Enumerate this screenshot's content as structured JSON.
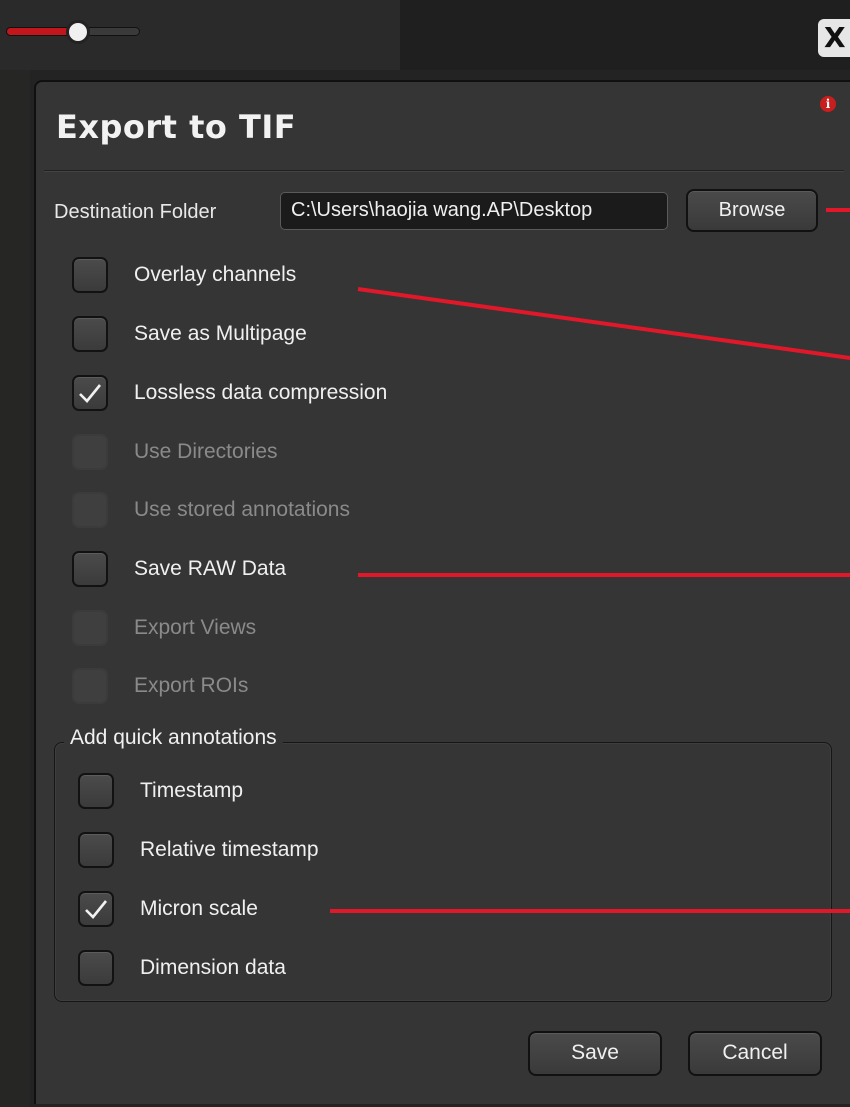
{
  "close_glyph": "X",
  "dialog": {
    "title": "Export to TIF",
    "info_glyph": "i",
    "destination": {
      "label": "Destination Folder",
      "value": "C:\\Users\\haojia wang.AP\\Desktop",
      "browse_label": "Browse"
    },
    "options": [
      {
        "label": "Overlay channels",
        "checked": false,
        "enabled": true
      },
      {
        "label": "Save as Multipage",
        "checked": false,
        "enabled": true
      },
      {
        "label": "Lossless data compression",
        "checked": true,
        "enabled": true
      },
      {
        "label": "Use Directories",
        "checked": false,
        "enabled": false
      },
      {
        "label": "Use stored annotations",
        "checked": false,
        "enabled": false
      },
      {
        "label": "Save RAW Data",
        "checked": false,
        "enabled": true
      },
      {
        "label": "Export Views",
        "checked": false,
        "enabled": false
      },
      {
        "label": "Export ROIs",
        "checked": false,
        "enabled": false
      }
    ],
    "quick_annotations": {
      "legend": "Add quick annotations",
      "items": [
        {
          "label": "Timestamp",
          "checked": false
        },
        {
          "label": "Relative timestamp",
          "checked": false
        },
        {
          "label": "Micron scale",
          "checked": true
        },
        {
          "label": "Dimension data",
          "checked": false
        }
      ]
    },
    "save_label": "Save",
    "cancel_label": "Cancel"
  },
  "colors": {
    "accent_red": "#c2161d",
    "annotation_line": "#e0182a",
    "dialog_bg": "#353535"
  }
}
